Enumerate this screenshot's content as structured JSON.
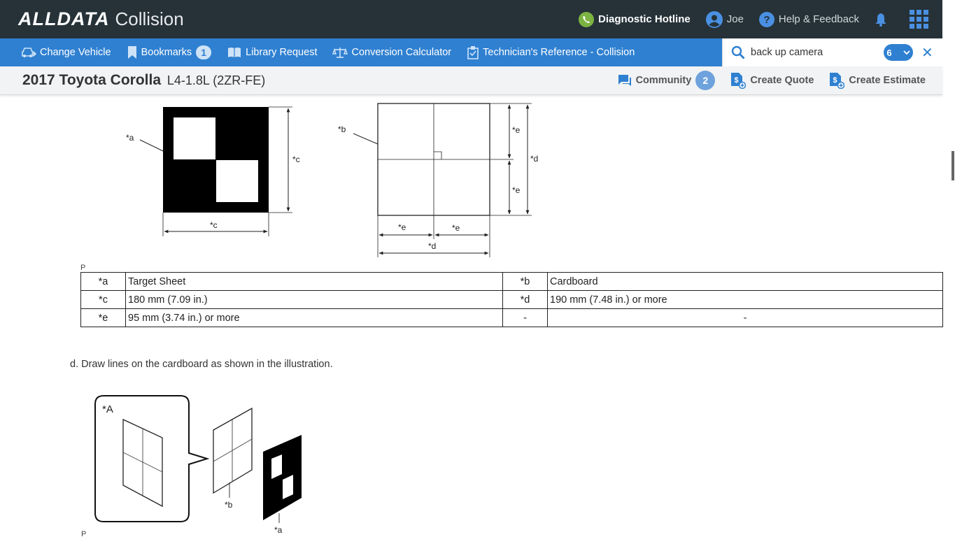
{
  "brand": {
    "logo": "ALLDATA",
    "product": "Collision"
  },
  "topbar": {
    "hotline": "Diagnostic Hotline",
    "user": "Joe",
    "help": "Help & Feedback"
  },
  "nav": {
    "change_vehicle": "Change Vehicle",
    "bookmarks": "Bookmarks",
    "bookmarks_count": "1",
    "library_request": "Library Request",
    "conversion_calculator": "Conversion Calculator",
    "tech_reference": "Technician's Reference - Collision"
  },
  "search": {
    "value": "back up camera",
    "results": "6"
  },
  "vehicle": {
    "name": "2017 Toyota Corolla",
    "engine": "L4-1.8L (2ZR-FE)",
    "community": "Community",
    "community_count": "2",
    "create_quote": "Create Quote",
    "create_estimate": "Create Estimate"
  },
  "diagram1": {
    "label_a": "*a",
    "label_b": "*b",
    "label_c": "*c",
    "label_d": "*d",
    "label_e": "*e",
    "p_mark": "P"
  },
  "legend": {
    "rows": [
      {
        "k1": "*a",
        "v1": "Target Sheet",
        "k2": "*b",
        "v2": "Cardboard"
      },
      {
        "k1": "*c",
        "v1": "180 mm (7.09 in.)",
        "k2": "*d",
        "v2": "190 mm (7.48 in.) or more"
      },
      {
        "k1": "*e",
        "v1": "95 mm (3.74 in.) or more",
        "k2": "-",
        "v2": "-"
      }
    ]
  },
  "step_d": "d. Draw lines on the cardboard as shown in the illustration.",
  "diagram2": {
    "label_A": "*A",
    "label_a": "*a",
    "label_b": "*b",
    "p_mark": "P"
  },
  "colors": {
    "topbar": "#263238",
    "navbar": "#2f80d1",
    "accent": "#2f80d1",
    "hotline_green": "#7cb342"
  }
}
